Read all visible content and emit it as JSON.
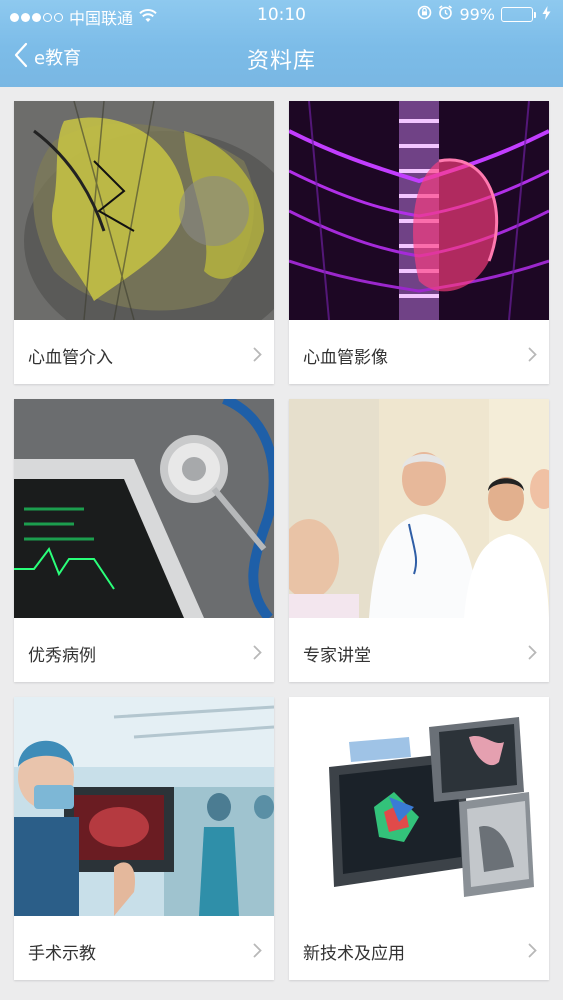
{
  "status_bar": {
    "carrier": "中国联通",
    "time": "10:10",
    "battery_percent": "99%",
    "battery_level": 0.99,
    "battery_color": "#4cd964"
  },
  "nav": {
    "back_label": "e教育",
    "title": "资料库"
  },
  "cards": [
    {
      "label": "心血管介入",
      "icon": "chevron-right-icon"
    },
    {
      "label": "心血管影像",
      "icon": "chevron-right-icon"
    },
    {
      "label": "优秀病例",
      "icon": "chevron-right-icon"
    },
    {
      "label": "专家讲堂",
      "icon": "chevron-right-icon"
    },
    {
      "label": "手术示教",
      "icon": "chevron-right-icon"
    },
    {
      "label": "新技术及应用",
      "icon": "chevron-right-icon"
    }
  ],
  "colors": {
    "header": "#7cbce8",
    "background": "#ececed",
    "card": "#ffffff",
    "label_text": "#333333",
    "chevron": "#b8b8b8"
  }
}
